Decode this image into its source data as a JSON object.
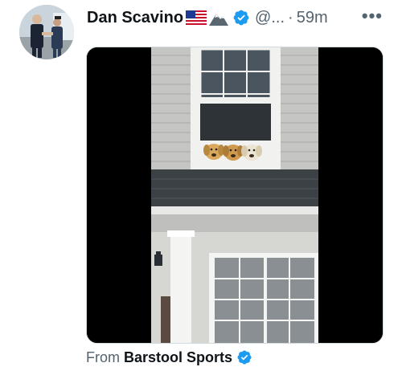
{
  "tweet": {
    "author_name": "Dan Scavino",
    "handle": "@...",
    "separator": "·",
    "time": "59m",
    "more_label": "•••",
    "icons": {
      "flag": "us-flag-icon",
      "mountain": "snow-mountain-icon",
      "verified": "verified-badge-icon",
      "more": "more-options-icon"
    },
    "accent": "#1d9bf0"
  },
  "media": {
    "kind": "video",
    "description_icon": "house-window-dogs-video"
  },
  "attribution": {
    "prefix": "From",
    "source": "Barstool Sports"
  }
}
